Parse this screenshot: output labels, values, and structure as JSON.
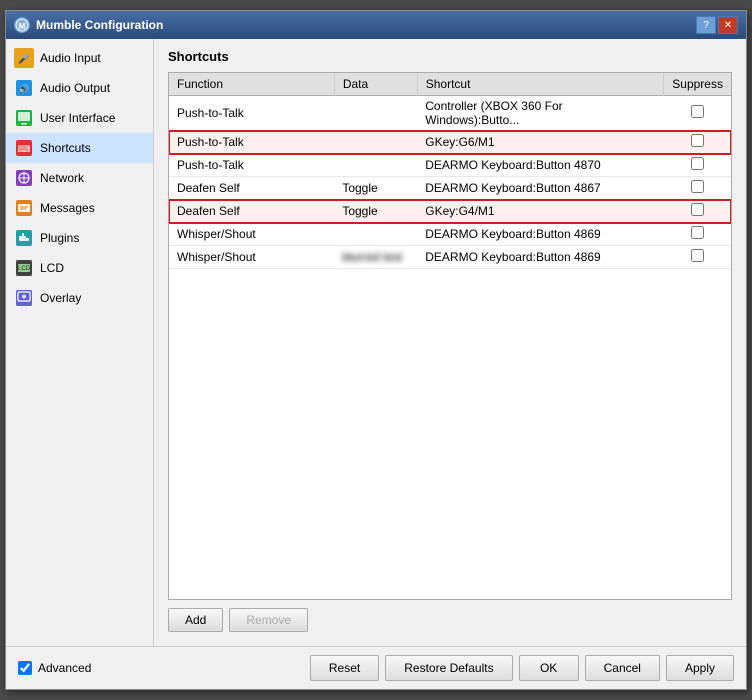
{
  "window": {
    "title": "Mumble Configuration",
    "icon": "M"
  },
  "sidebar": {
    "items": [
      {
        "id": "audio-input",
        "label": "Audio Input",
        "iconClass": "icon-audio-input",
        "iconText": "🎤"
      },
      {
        "id": "audio-output",
        "label": "Audio Output",
        "iconClass": "icon-audio-output",
        "iconText": "🔊"
      },
      {
        "id": "user-interface",
        "label": "User Interface",
        "iconClass": "icon-user-interface",
        "iconText": "🖥"
      },
      {
        "id": "shortcuts",
        "label": "Shortcuts",
        "iconClass": "icon-shortcuts",
        "iconText": "⌨",
        "active": true
      },
      {
        "id": "network",
        "label": "Network",
        "iconClass": "icon-network",
        "iconText": "🌐"
      },
      {
        "id": "messages",
        "label": "Messages",
        "iconClass": "icon-messages",
        "iconText": "✉"
      },
      {
        "id": "plugins",
        "label": "Plugins",
        "iconClass": "icon-plugins",
        "iconText": "🔌"
      },
      {
        "id": "lcd",
        "label": "LCD",
        "iconClass": "icon-lcd",
        "iconText": "LCD"
      },
      {
        "id": "overlay",
        "label": "Overlay",
        "iconClass": "icon-overlay",
        "iconText": "◈"
      }
    ]
  },
  "main": {
    "title": "Shortcuts",
    "table": {
      "headers": [
        "Function",
        "Data",
        "Shortcut",
        "Suppress"
      ],
      "rows": [
        {
          "function": "Push-to-Talk",
          "data": "",
          "shortcut": "Controller (XBOX 360 For Windows):Butto...",
          "suppress": false,
          "highlighted": false,
          "blurred_data": false
        },
        {
          "function": "Push-to-Talk",
          "data": "",
          "shortcut": "GKey:G6/M1",
          "suppress": false,
          "highlighted": true,
          "blurred_data": false
        },
        {
          "function": "Push-to-Talk",
          "data": "",
          "shortcut": "DEARMO Keyboard:Button 4870",
          "suppress": false,
          "highlighted": false,
          "blurred_data": false
        },
        {
          "function": "Deafen Self",
          "data": "Toggle",
          "shortcut": "DEARMO Keyboard:Button 4867",
          "suppress": false,
          "highlighted": false,
          "blurred_data": false
        },
        {
          "function": "Deafen Self",
          "data": "Toggle",
          "shortcut": "GKey:G4/M1",
          "suppress": false,
          "highlighted": true,
          "blurred_data": false
        },
        {
          "function": "Whisper/Shout",
          "data": "",
          "shortcut": "DEARMO Keyboard:Button 4869",
          "suppress": false,
          "highlighted": false,
          "blurred_data": false
        },
        {
          "function": "Whisper/Shout",
          "data": "BLURRED",
          "shortcut": "DEARMO Keyboard:Button 4869",
          "suppress": false,
          "highlighted": false,
          "blurred_data": true
        }
      ]
    },
    "buttons": {
      "add": "Add",
      "remove": "Remove"
    }
  },
  "footer": {
    "advanced_label": "Advanced",
    "advanced_checked": true,
    "reset_label": "Reset",
    "restore_defaults_label": "Restore Defaults",
    "ok_label": "OK",
    "cancel_label": "Cancel",
    "apply_label": "Apply"
  }
}
